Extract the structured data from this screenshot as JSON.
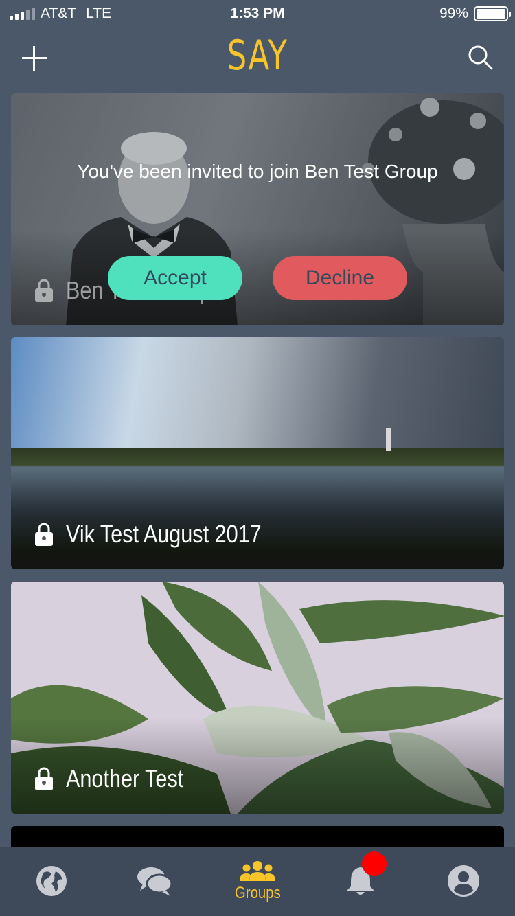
{
  "status_bar": {
    "carrier": "AT&T",
    "network": "LTE",
    "time": "1:53 PM",
    "battery_percent": "99%",
    "battery_level": 0.99
  },
  "header": {
    "logo": "SAY",
    "add_icon": "plus-icon",
    "search_icon": "search-icon"
  },
  "groups": [
    {
      "name": "Ben Test Group",
      "locked": true,
      "invite": {
        "message": "You've been invited to join Ben Test Group",
        "accept_label": "Accept",
        "decline_label": "Decline"
      }
    },
    {
      "name": "Vik Test August 2017",
      "locked": true
    },
    {
      "name": "Another Test",
      "locked": true
    }
  ],
  "tabs": [
    {
      "icon": "globe-icon",
      "label": ""
    },
    {
      "icon": "chat-icon",
      "label": ""
    },
    {
      "icon": "groups-icon",
      "label": "Groups",
      "active": true
    },
    {
      "icon": "bell-icon",
      "label": "",
      "badge": true
    },
    {
      "icon": "profile-icon",
      "label": ""
    }
  ],
  "colors": {
    "background": "#4a586a",
    "accent": "#f7c52a",
    "accept": "#4fe0be",
    "decline": "#e05a5e",
    "tab_inactive": "#c8ccd2",
    "badge": "#ff0000"
  }
}
